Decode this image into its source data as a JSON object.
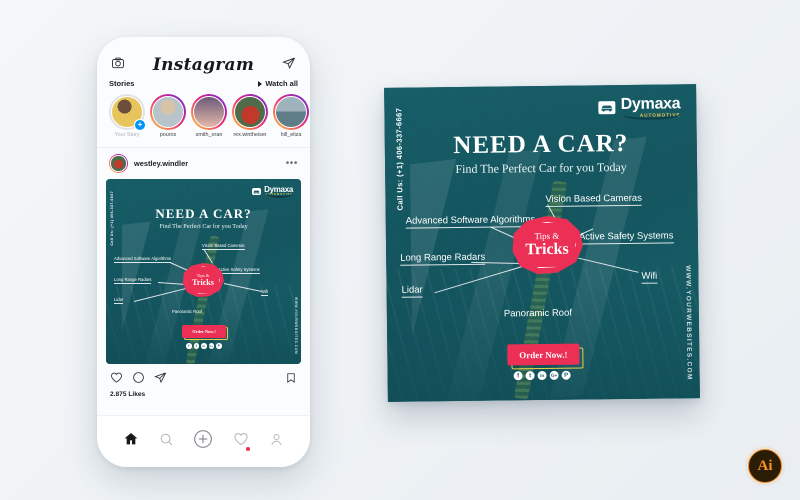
{
  "app": {
    "background_color": "#f1f5f8",
    "accent_red": "#ec2f55",
    "teal": "#1d5f69",
    "yellow": "#e8d14a"
  },
  "phone": {
    "instagram": {
      "logo_text": "Instagram",
      "camera_icon": "camera-icon",
      "send_icon": "paper-plane-icon",
      "stories_label": "Stories",
      "watch_all_label": "Watch all",
      "stories": [
        {
          "name": "Your Story",
          "has_add": true,
          "ring": "plain"
        },
        {
          "name": "pouros",
          "has_add": false,
          "ring": "gradient"
        },
        {
          "name": "smith_oran",
          "has_add": false,
          "ring": "gradient"
        },
        {
          "name": "rex.wintheiser",
          "has_add": false,
          "ring": "gradient"
        },
        {
          "name": "hill_eliza",
          "has_add": false,
          "ring": "gradient"
        }
      ],
      "post": {
        "username": "westley.windler",
        "more_options": "•••",
        "likes": "2.875 Likes",
        "actions": [
          "heart-icon",
          "comment-icon",
          "share-icon",
          "bookmark-icon"
        ]
      },
      "tabbar": [
        "home-icon",
        "search-icon",
        "add-post-icon",
        "activity-icon",
        "profile-icon"
      ]
    }
  },
  "poster": {
    "phone_vertical": "Call Us: (+1) 406-337-6667",
    "website_vertical": "WWW.YOURWEBSITES.COM",
    "logo": {
      "name": "Dymaxa",
      "sub": "AUTOMOTIVE",
      "icon": "car-icon"
    },
    "title": "NEED A CAR?",
    "subtitle": "Find The Perfect Car for you Today",
    "badge": {
      "line1": "Tips &",
      "line2": "Tricks"
    },
    "labels": [
      {
        "text": "Vision Based Cameras"
      },
      {
        "text": "Advanced Software Algorithms"
      },
      {
        "text": "Active Safety Systems"
      },
      {
        "text": "Long Range Radars"
      },
      {
        "text": "Wifi"
      },
      {
        "text": "Lidar"
      },
      {
        "text": "Panoramic Roof"
      }
    ],
    "cta": "Order Now.!",
    "socials": [
      {
        "name": "facebook-icon",
        "glyph": "f"
      },
      {
        "name": "twitter-icon",
        "glyph": "t"
      },
      {
        "name": "linkedin-icon",
        "glyph": "in"
      },
      {
        "name": "googleplus-icon",
        "glyph": "G+"
      },
      {
        "name": "pinterest-icon",
        "glyph": "P"
      }
    ]
  },
  "watermark": {
    "label": "Ai"
  }
}
